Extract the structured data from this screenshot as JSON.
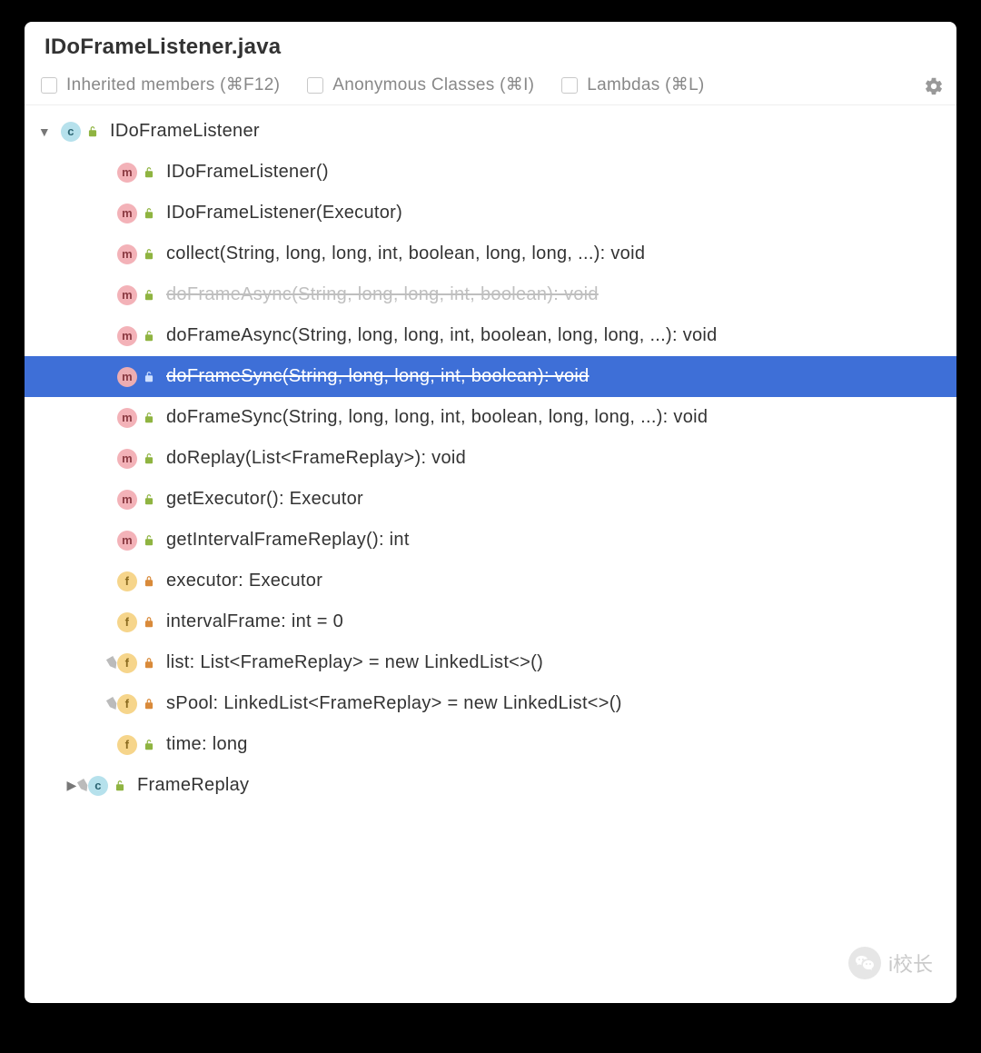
{
  "title": "IDoFrameListener.java",
  "toolbar": {
    "inherited": "Inherited members (⌘F12)",
    "anonymous": "Anonymous Classes (⌘I)",
    "lambdas": "Lambdas (⌘L)"
  },
  "tree": {
    "items": [
      {
        "level": 0,
        "expander": "down",
        "kind": "c",
        "access": "unlocked",
        "pinned": false,
        "deprecated": false,
        "selected": false,
        "label": "IDoFrameListener"
      },
      {
        "level": 1,
        "expander": "",
        "kind": "m",
        "access": "unlocked",
        "pinned": false,
        "deprecated": false,
        "selected": false,
        "label": "IDoFrameListener()"
      },
      {
        "level": 1,
        "expander": "",
        "kind": "m",
        "access": "unlocked",
        "pinned": false,
        "deprecated": false,
        "selected": false,
        "label": "IDoFrameListener(Executor)"
      },
      {
        "level": 1,
        "expander": "",
        "kind": "m",
        "access": "unlocked",
        "pinned": false,
        "deprecated": false,
        "selected": false,
        "label": "collect(String, long, long, int, boolean, long, long, ...): void"
      },
      {
        "level": 1,
        "expander": "",
        "kind": "m",
        "access": "unlocked",
        "pinned": false,
        "deprecated": true,
        "selected": false,
        "label": "doFrameAsync(String, long, long, int, boolean): void"
      },
      {
        "level": 1,
        "expander": "",
        "kind": "m",
        "access": "unlocked",
        "pinned": false,
        "deprecated": false,
        "selected": false,
        "label": "doFrameAsync(String, long, long, int, boolean, long, long, ...): void"
      },
      {
        "level": 1,
        "expander": "",
        "kind": "m",
        "access": "unlocked",
        "pinned": false,
        "deprecated": true,
        "selected": true,
        "label": "doFrameSync(String, long, long, int, boolean): void"
      },
      {
        "level": 1,
        "expander": "",
        "kind": "m",
        "access": "unlocked",
        "pinned": false,
        "deprecated": false,
        "selected": false,
        "label": "doFrameSync(String, long, long, int, boolean, long, long, ...): void"
      },
      {
        "level": 1,
        "expander": "",
        "kind": "m",
        "access": "unlocked",
        "pinned": false,
        "deprecated": false,
        "selected": false,
        "label": "doReplay(List<FrameReplay>): void"
      },
      {
        "level": 1,
        "expander": "",
        "kind": "m",
        "access": "unlocked",
        "pinned": false,
        "deprecated": false,
        "selected": false,
        "label": "getExecutor(): Executor"
      },
      {
        "level": 1,
        "expander": "",
        "kind": "m",
        "access": "unlocked",
        "pinned": false,
        "deprecated": false,
        "selected": false,
        "label": "getIntervalFrameReplay(): int"
      },
      {
        "level": 1,
        "expander": "",
        "kind": "f",
        "access": "locked",
        "pinned": false,
        "deprecated": false,
        "selected": false,
        "label": "executor: Executor"
      },
      {
        "level": 1,
        "expander": "",
        "kind": "f",
        "access": "locked",
        "pinned": false,
        "deprecated": false,
        "selected": false,
        "label": "intervalFrame: int = 0"
      },
      {
        "level": 1,
        "expander": "",
        "kind": "f",
        "access": "locked",
        "pinned": true,
        "deprecated": false,
        "selected": false,
        "label": "list: List<FrameReplay> = new LinkedList<>()"
      },
      {
        "level": 1,
        "expander": "",
        "kind": "f",
        "access": "locked",
        "pinned": true,
        "deprecated": false,
        "selected": false,
        "label": "sPool: LinkedList<FrameReplay> = new LinkedList<>()"
      },
      {
        "level": 1,
        "expander": "",
        "kind": "f",
        "access": "unlocked",
        "pinned": false,
        "deprecated": false,
        "selected": false,
        "label": "time: long"
      },
      {
        "level": 0,
        "expander": "right",
        "kind": "c",
        "access": "unlocked",
        "pinned": true,
        "deprecated": false,
        "selected": false,
        "label": "FrameReplay",
        "inset": true
      }
    ]
  },
  "watermark": {
    "text": "i校长"
  }
}
